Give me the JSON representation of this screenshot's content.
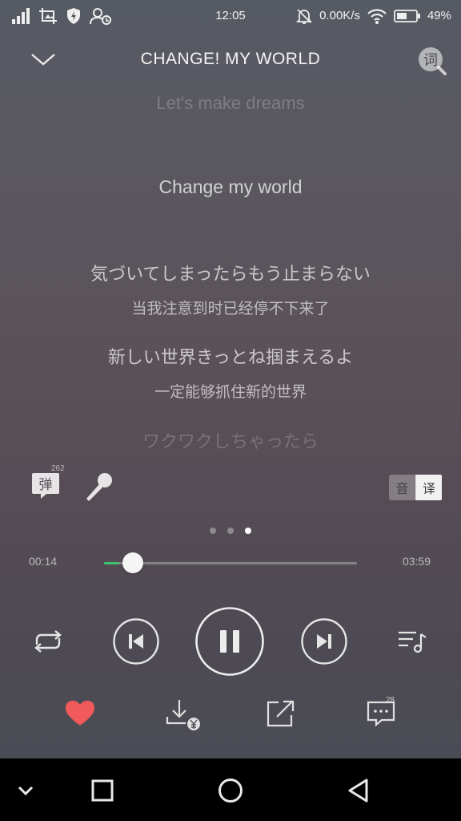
{
  "status_bar": {
    "time": "12:05",
    "net_speed": "0.00K/s",
    "battery": "49%",
    "icons": [
      "signal-icon",
      "screenshot-icon",
      "shield-icon",
      "user-add-icon",
      "mute-icon",
      "wifi-icon",
      "battery-icon"
    ]
  },
  "header": {
    "title": "CHANGE! MY WORLD",
    "back_icon": "chevron-down-icon",
    "lyric_search_label": "词"
  },
  "lyrics": {
    "prev_line": "Let's make dreams",
    "current_line": "Change my world",
    "line2_jp": "気づいてしまったらもう止まらない",
    "line2_cn": "当我注意到时已经停不下来了",
    "line3_jp": "新しい世界きっとね掴まえるよ",
    "line3_cn": "一定能够抓住新的世界",
    "next_line": "ワクワクしちゃったら"
  },
  "tools": {
    "danmaku_label": "弹",
    "danmaku_count": "262",
    "toggle_yin": "音",
    "toggle_yi": "译"
  },
  "pager": {
    "count": 3,
    "active_index": 2
  },
  "progress": {
    "current": "00:14",
    "total": "03:59",
    "fraction": 0.0586
  },
  "actions": {
    "comment_count": "28",
    "liked": true
  },
  "colors": {
    "accent_green": "#3bc46d",
    "like_red": "#f05a5a"
  }
}
